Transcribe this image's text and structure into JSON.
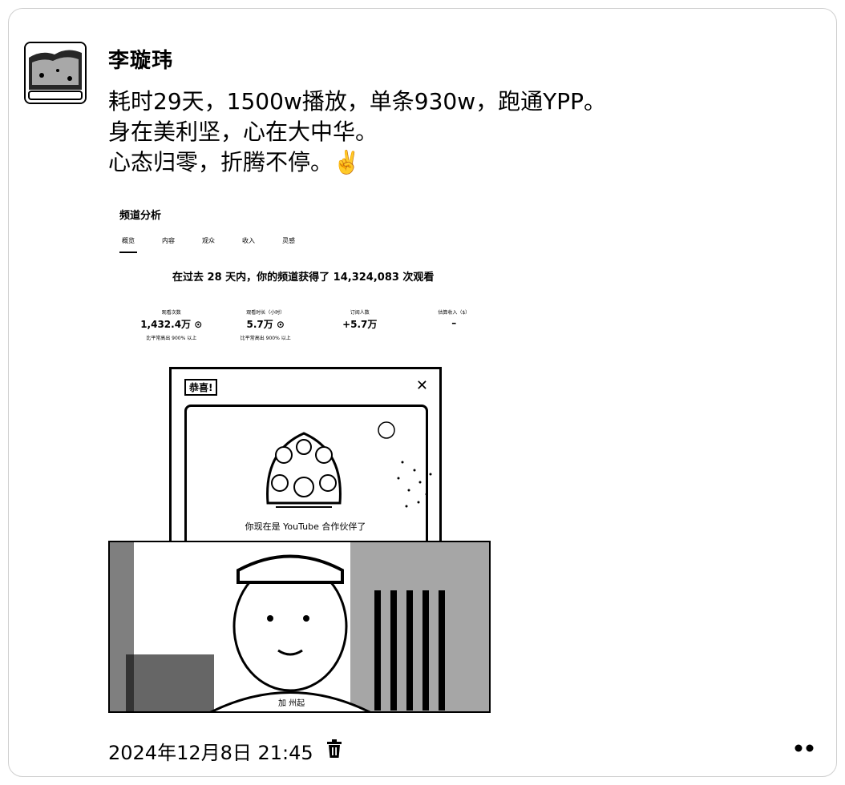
{
  "author": {
    "name": "李璇玮"
  },
  "post": {
    "lines": [
      "耗时29天，1500w播放，单条930w，跑通YPP。",
      "身在美利坚，心在大中华。",
      "心态归零，折腾不停。✌️"
    ]
  },
  "screenshot": {
    "title": "频道分析",
    "tabs": [
      "概览",
      "内容",
      "观众",
      "收入",
      "灵感"
    ],
    "headline": "在过去 28 天内，你的频道获得了 14,324,083 次观看",
    "metrics": [
      {
        "label": "观看次数",
        "value": "1,432.4万 ⊙",
        "sub": "比平常高出 900% 以上"
      },
      {
        "label": "观看时长（小时）",
        "value": "5.7万 ⊙",
        "sub": "比平常高出 900% 以上"
      },
      {
        "label": "订阅人数",
        "value": "+5.7万",
        "sub": ""
      },
      {
        "label": "估算收入（$）",
        "value": "–",
        "sub": ""
      }
    ],
    "dialog": {
      "badge": "恭喜!",
      "close": "✕",
      "message": "你现在是 YouTube 合作伙伴了"
    },
    "photo_caption": "加 州起"
  },
  "meta": {
    "timestamp": "2024年12月8日 21:45"
  },
  "icons": {
    "trash": "trash-icon",
    "more": "more-icon"
  }
}
